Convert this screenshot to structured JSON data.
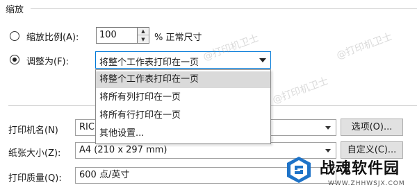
{
  "scaling": {
    "title": "缩放",
    "adjust_to_label": "缩放比例(A):",
    "percent_value": "100",
    "percent_label": "% 正常尺寸",
    "fit_to_label": "调整为(F):",
    "fit_to_value": "将整个工作表打印在一页",
    "options": [
      "将整个工作表打印在一页",
      "将所有列打印在一页",
      "将所有行打印在一页",
      "其他设置..."
    ],
    "selected_option_index": 0
  },
  "printer": {
    "label": "打印机名(N)",
    "value": "RIC",
    "button": "选项(O)..."
  },
  "paper": {
    "label": "纸张大小(Z):",
    "value": "A4 (210 x 297 mm)",
    "button": "自定义(C)..."
  },
  "quality": {
    "label": "打印质量(Q):",
    "value": "600 点/英寸"
  },
  "watermark": "@打印机卫士",
  "logo": {
    "text": "战魂软件园",
    "url": "WWW.ZHHWSJX.COM"
  },
  "colors": {
    "focus_border": "#0078d7",
    "selected_item": "#dadada",
    "logo_blue": "#1e73c8"
  }
}
